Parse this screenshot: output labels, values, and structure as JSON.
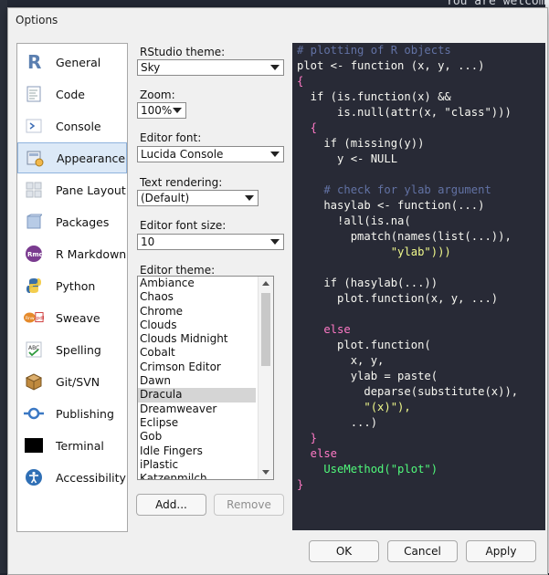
{
  "background": {
    "editor_text": "You are welcom"
  },
  "window": {
    "title": "Options"
  },
  "sidebar": {
    "items": [
      {
        "label": "General",
        "icon": "r-logo-icon"
      },
      {
        "label": "Code",
        "icon": "code-doc-icon"
      },
      {
        "label": "Console",
        "icon": "console-prompt-icon"
      },
      {
        "label": "Appearance",
        "icon": "appearance-palette-icon"
      },
      {
        "label": "Pane Layout",
        "icon": "pane-layout-icon"
      },
      {
        "label": "Packages",
        "icon": "packages-cube-icon"
      },
      {
        "label": "R Markdown",
        "icon": "rmd-icon"
      },
      {
        "label": "Python",
        "icon": "python-icon"
      },
      {
        "label": "Sweave",
        "icon": "sweave-icon"
      },
      {
        "label": "Spelling",
        "icon": "spelling-abc-icon"
      },
      {
        "label": "Git/SVN",
        "icon": "git-box-icon"
      },
      {
        "label": "Publishing",
        "icon": "publishing-icon"
      },
      {
        "label": "Terminal",
        "icon": "terminal-icon"
      },
      {
        "label": "Accessibility",
        "icon": "accessibility-icon"
      }
    ],
    "active": "Appearance"
  },
  "appearance": {
    "theme_label": "RStudio theme:",
    "theme_value": "Sky",
    "zoom_label": "Zoom:",
    "zoom_value": "100%",
    "font_label": "Editor font:",
    "font_value": "Lucida Console",
    "rendering_label": "Text rendering:",
    "rendering_value": "(Default)",
    "font_size_label": "Editor font size:",
    "font_size_value": "10",
    "editor_theme_label": "Editor theme:",
    "editor_themes": [
      "Ambiance",
      "Chaos",
      "Chrome",
      "Clouds",
      "Clouds Midnight",
      "Cobalt",
      "Crimson Editor",
      "Dawn",
      "Dracula",
      "Dreamweaver",
      "Eclipse",
      "Gob",
      "Idle Fingers",
      "iPlastic",
      "Katzenmilch"
    ],
    "selected_theme": "Dracula",
    "add_label": "Add...",
    "remove_label": "Remove"
  },
  "preview": {
    "lines": [
      "# plotting of R objects",
      "plot <- function (x, y, ...)",
      "{",
      "  if (is.function(x) &&",
      "      is.null(attr(x, \"class\")))",
      "  {",
      "    if (missing(y))",
      "      y <- NULL",
      "",
      "    # check for ylab argument",
      "    hasylab <- function(...)",
      "      !all(is.na(",
      "        pmatch(names(list(...)),",
      "              \"ylab\")))",
      "",
      "    if (hasylab(...))",
      "      plot.function(x, y, ...)",
      "",
      "    else",
      "      plot.function(",
      "        x, y,",
      "        ylab = paste(",
      "          deparse(substitute(x)),",
      "          \"(x)\"),",
      "        ...)",
      "  }",
      "  else",
      "    UseMethod(\"plot\")",
      "}"
    ]
  },
  "footer": {
    "ok_label": "OK",
    "cancel_label": "Cancel",
    "apply_label": "Apply"
  }
}
